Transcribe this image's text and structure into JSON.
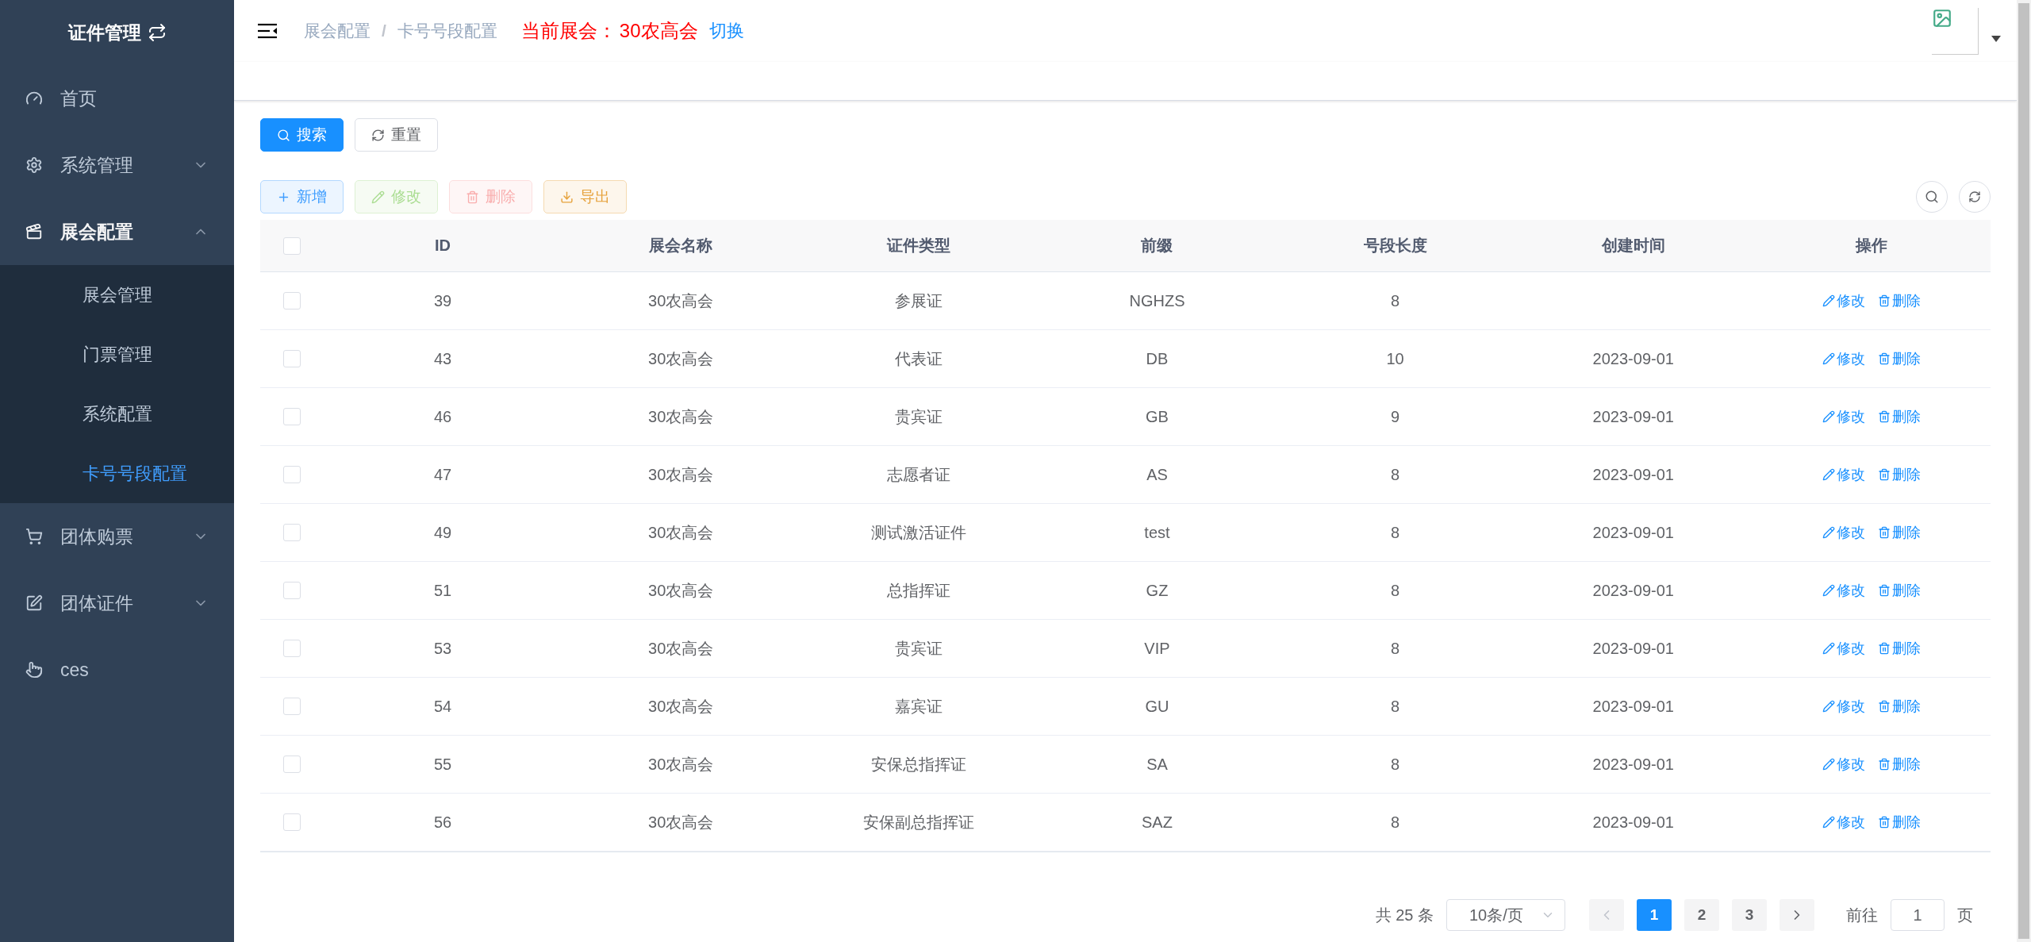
{
  "sidebar": {
    "title": "证件管理",
    "items": [
      {
        "label": "首页",
        "selected": false
      },
      {
        "label": "系统管理",
        "selected": false,
        "expanded": false
      },
      {
        "label": "展会配置",
        "selected": true,
        "expanded": true,
        "children": [
          {
            "label": "展会管理",
            "selected": false
          },
          {
            "label": "门票管理",
            "selected": false
          },
          {
            "label": "系统配置",
            "selected": false
          },
          {
            "label": "卡号号段配置",
            "selected": true
          }
        ]
      },
      {
        "label": "团体购票",
        "selected": false,
        "expanded": false
      },
      {
        "label": "团体证件",
        "selected": false,
        "expanded": false
      },
      {
        "label": "ces",
        "selected": false
      }
    ]
  },
  "navbar": {
    "breadcrumb": [
      "展会配置",
      "卡号号段配置"
    ],
    "separator": "/",
    "current_label": "当前展会：",
    "current_value": "30农高会",
    "switch_link": "切换"
  },
  "search_buttons": [
    {
      "label": "搜索",
      "kind": "primary"
    },
    {
      "label": "重置",
      "kind": "default"
    }
  ],
  "toolbar": [
    {
      "label": "新增",
      "kind": "primary",
      "disabled": false
    },
    {
      "label": "修改",
      "kind": "success",
      "disabled": true
    },
    {
      "label": "删除",
      "kind": "danger",
      "disabled": true
    },
    {
      "label": "导出",
      "kind": "warning",
      "disabled": false
    }
  ],
  "table": {
    "header_checked": false,
    "columns": [
      "ID",
      "展会名称",
      "证件类型",
      "前缀",
      "号段长度",
      "创建时间",
      "操作"
    ],
    "rows": [
      {
        "checked": false,
        "cells": [
          "39",
          "30农高会",
          "参展证",
          "NGHZS",
          "8",
          ""
        ],
        "actions": [
          "修改",
          "删除"
        ]
      },
      {
        "checked": false,
        "cells": [
          "43",
          "30农高会",
          "代表证",
          "DB",
          "10",
          "2023-09-01"
        ],
        "actions": [
          "修改",
          "删除"
        ]
      },
      {
        "checked": false,
        "cells": [
          "46",
          "30农高会",
          "贵宾证",
          "GB",
          "9",
          "2023-09-01"
        ],
        "actions": [
          "修改",
          "删除"
        ]
      },
      {
        "checked": false,
        "cells": [
          "47",
          "30农高会",
          "志愿者证",
          "AS",
          "8",
          "2023-09-01"
        ],
        "actions": [
          "修改",
          "删除"
        ]
      },
      {
        "checked": false,
        "cells": [
          "49",
          "30农高会",
          "测试激活证件",
          "test",
          "8",
          "2023-09-01"
        ],
        "actions": [
          "修改",
          "删除"
        ]
      },
      {
        "checked": false,
        "cells": [
          "51",
          "30农高会",
          "总指挥证",
          "GZ",
          "8",
          "2023-09-01"
        ],
        "actions": [
          "修改",
          "删除"
        ]
      },
      {
        "checked": false,
        "cells": [
          "53",
          "30农高会",
          "贵宾证",
          "VIP",
          "8",
          "2023-09-01"
        ],
        "actions": [
          "修改",
          "删除"
        ]
      },
      {
        "checked": false,
        "cells": [
          "54",
          "30农高会",
          "嘉宾证",
          "GU",
          "8",
          "2023-09-01"
        ],
        "actions": [
          "修改",
          "删除"
        ]
      },
      {
        "checked": false,
        "cells": [
          "55",
          "30农高会",
          "安保总指挥证",
          "SA",
          "8",
          "2023-09-01"
        ],
        "actions": [
          "修改",
          "删除"
        ]
      },
      {
        "checked": false,
        "cells": [
          "56",
          "30农高会",
          "安保副总指挥证",
          "SAZ",
          "8",
          "2023-09-01"
        ],
        "actions": [
          "修改",
          "删除"
        ]
      }
    ]
  },
  "pagination": {
    "total": "共 25 条",
    "page_size": "10条/页",
    "pages": [
      {
        "label": "1",
        "selected": true
      },
      {
        "label": "2",
        "selected": false
      },
      {
        "label": "3",
        "selected": false
      }
    ],
    "goto_label": "前往",
    "goto_value": "1",
    "goto_suffix": "页"
  }
}
